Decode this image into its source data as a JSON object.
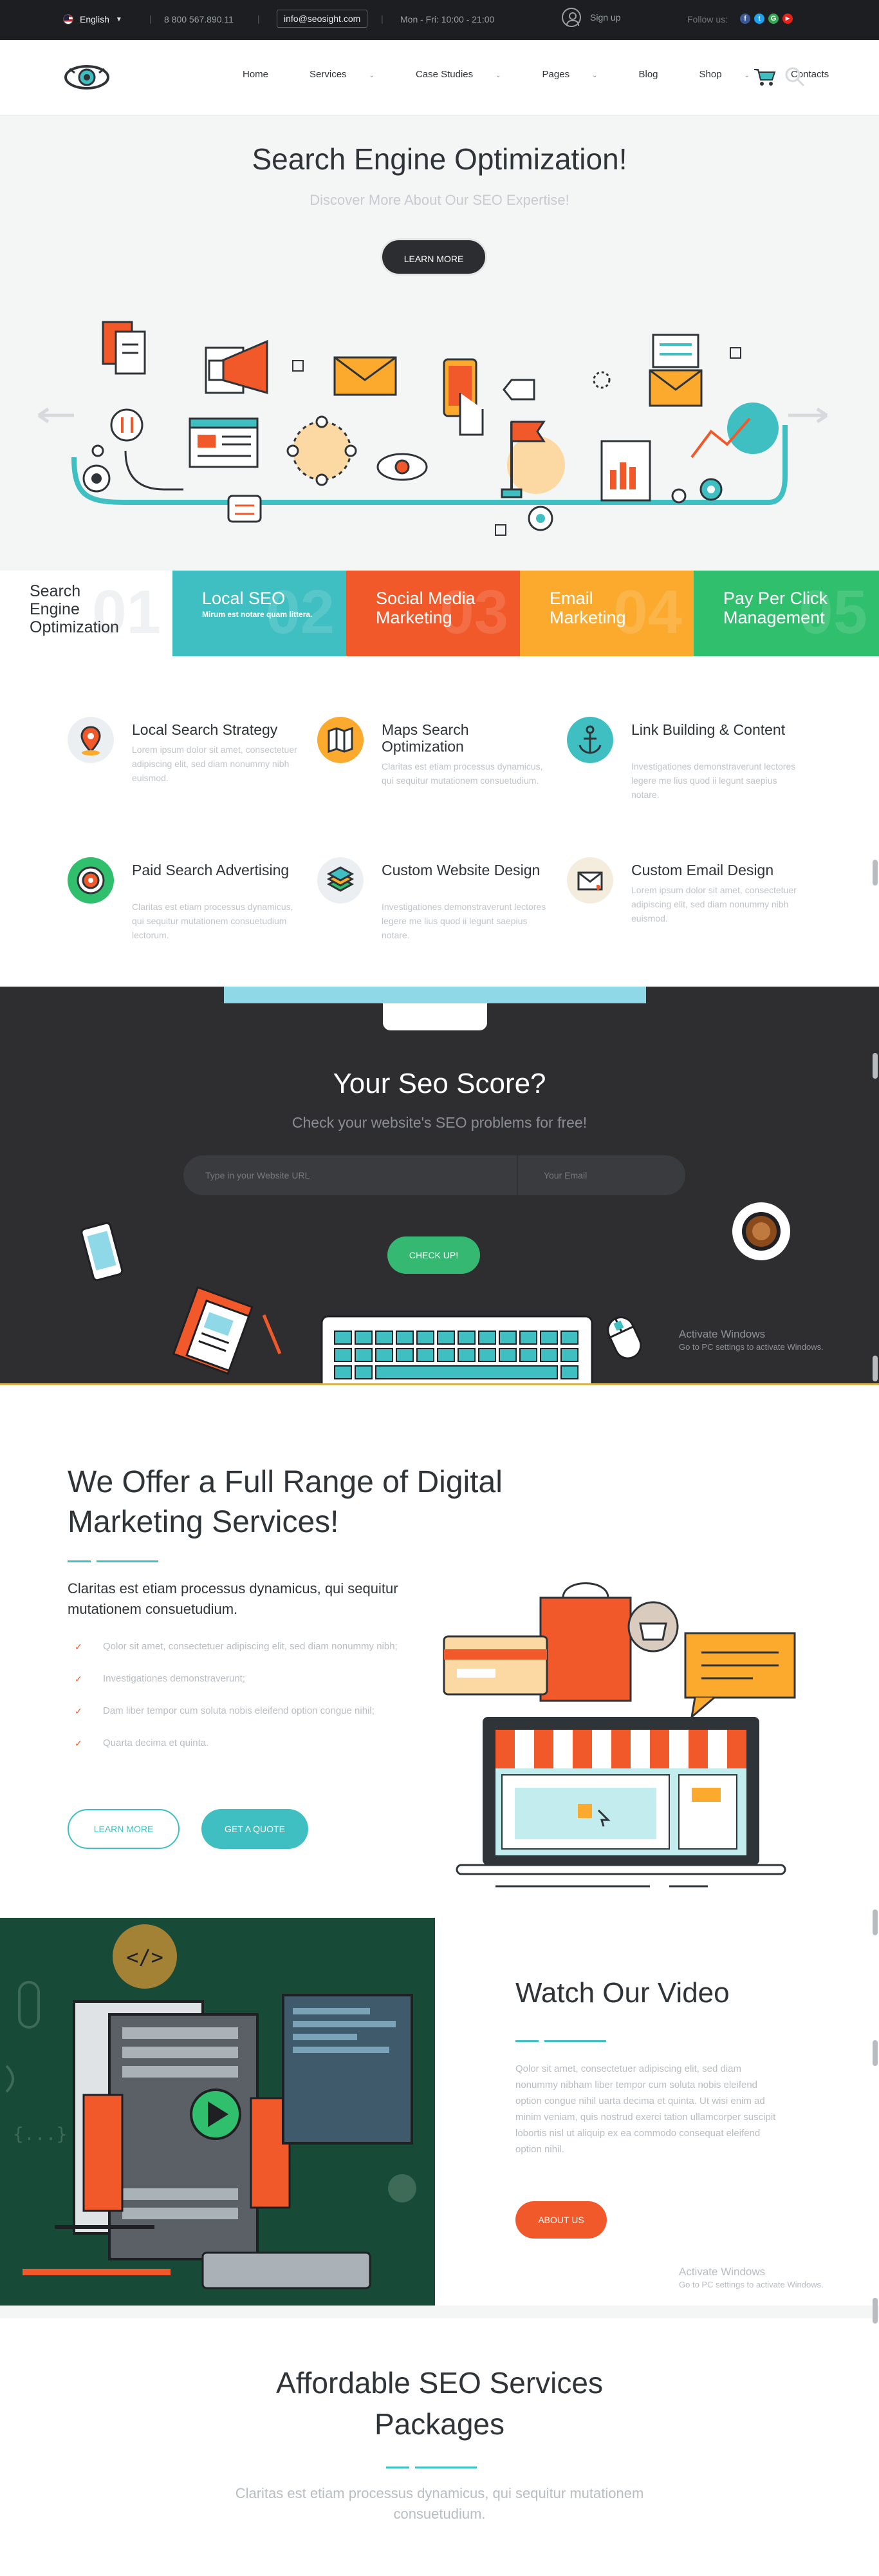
{
  "topbar": {
    "language": "English",
    "phone": "8 800 567.890.11",
    "email": "info@seosight.com",
    "hours": "Mon - Fri: 10:00 - 21:00",
    "signup": "Sign up",
    "follow": "Follow us:",
    "social": [
      "f",
      "t",
      "G",
      "▶"
    ]
  },
  "nav": {
    "menu": [
      {
        "label": "Home",
        "dropdown": false
      },
      {
        "label": "Services",
        "dropdown": true
      },
      {
        "label": "Case Studies",
        "dropdown": true
      },
      {
        "label": "Pages",
        "dropdown": true
      },
      {
        "label": "Blog",
        "dropdown": false
      },
      {
        "label": "Shop",
        "dropdown": true
      },
      {
        "label": "Contacts",
        "dropdown": false
      }
    ],
    "icons": [
      "eye-logo-icon",
      "cart-icon",
      "search-icon"
    ]
  },
  "hero": {
    "title": "Search Engine Optimization!",
    "subtitle": "Discover More About Our SEO Expertise!",
    "button": "LEARN MORE"
  },
  "tabs": [
    {
      "num": "01",
      "title": "Search Engine Optimization",
      "desc": ""
    },
    {
      "num": "02",
      "title": "Local SEO",
      "desc": "Mirum est notare quam littera."
    },
    {
      "num": "03",
      "title": "Social Media Marketing",
      "desc": ""
    },
    {
      "num": "04",
      "title": "Email Marketing",
      "desc": ""
    },
    {
      "num": "05",
      "title": "Pay Per Click Management",
      "desc": ""
    }
  ],
  "features": [
    {
      "title": "Local Search Strategy",
      "text": "Lorem ipsum dolor sit amet, consectetuer adipiscing elit, sed diam nonummy nibh euismod."
    },
    {
      "title": "Maps Search Optimization",
      "text": "Claritas est etiam processus dynamicus, qui sequitur mutationem consuetudium."
    },
    {
      "title": "Link Building & Content",
      "text": "Investigationes demonstraverunt lectores legere me lius quod ii legunt saepius notare."
    },
    {
      "title": "Paid Search Advertising",
      "text": "Claritas est etiam processus dynamicus, qui sequitur mutationem consuetudium lectorum."
    },
    {
      "title": "Custom Website Design",
      "text": "Investigationes demonstraverunt lectores legere me lius quod ii legunt saepius notare."
    },
    {
      "title": "Custom Email Design",
      "text": "Lorem ipsum dolor sit amet, consectetuer adipiscing elit, sed diam nonummy nibh euismod."
    }
  ],
  "score": {
    "title": "Your Seo Score?",
    "subtitle": "Check your website's SEO problems for free!",
    "url_placeholder": "Type in your Website URL",
    "email_placeholder": "Your Email",
    "button": "CHECK UP!"
  },
  "activate": {
    "title": "Activate Windows",
    "sub": "Go to PC settings to activate Windows."
  },
  "range": {
    "title": "We Offer a Full Range of Digital Marketing Services!",
    "lead": "Claritas est etiam processus dynamicus, qui sequitur mutationem consuetudium.",
    "items": [
      "Qolor sit amet, consectetuer adipiscing elit, sed diam nonummy nibh;",
      "Investigationes demonstraverunt;",
      "Dam liber tempor cum soluta nobis eleifend option congue nihil;",
      "Quarta decima et quinta."
    ],
    "btn_more": "LEARN MORE",
    "btn_quote": "GET A QUOTE"
  },
  "video": {
    "title": "Watch Our Video",
    "text": "Qolor sit amet, consectetuer adipiscing elit, sed diam nonummy nibham liber tempor cum soluta nobis eleifend option congue nihil uarta decima et quinta. Ut wisi enim ad minim veniam, quis nostrud exerci tation ullamcorper suscipit lobortis nisl ut aliquip ex ea commodo consequat eleifend option nihil.",
    "button": "ABOUT US"
  },
  "packages": {
    "title": "Affordable SEO Services Packages",
    "subtitle": "Claritas est etiam processus dynamicus, qui sequitur mutationem consuetudium."
  },
  "colors": {
    "teal": "#3fbfc1",
    "orange": "#f2592a",
    "yellow": "#fbaa2e",
    "green": "#2fbf6d",
    "dark": "#2e2e30"
  }
}
